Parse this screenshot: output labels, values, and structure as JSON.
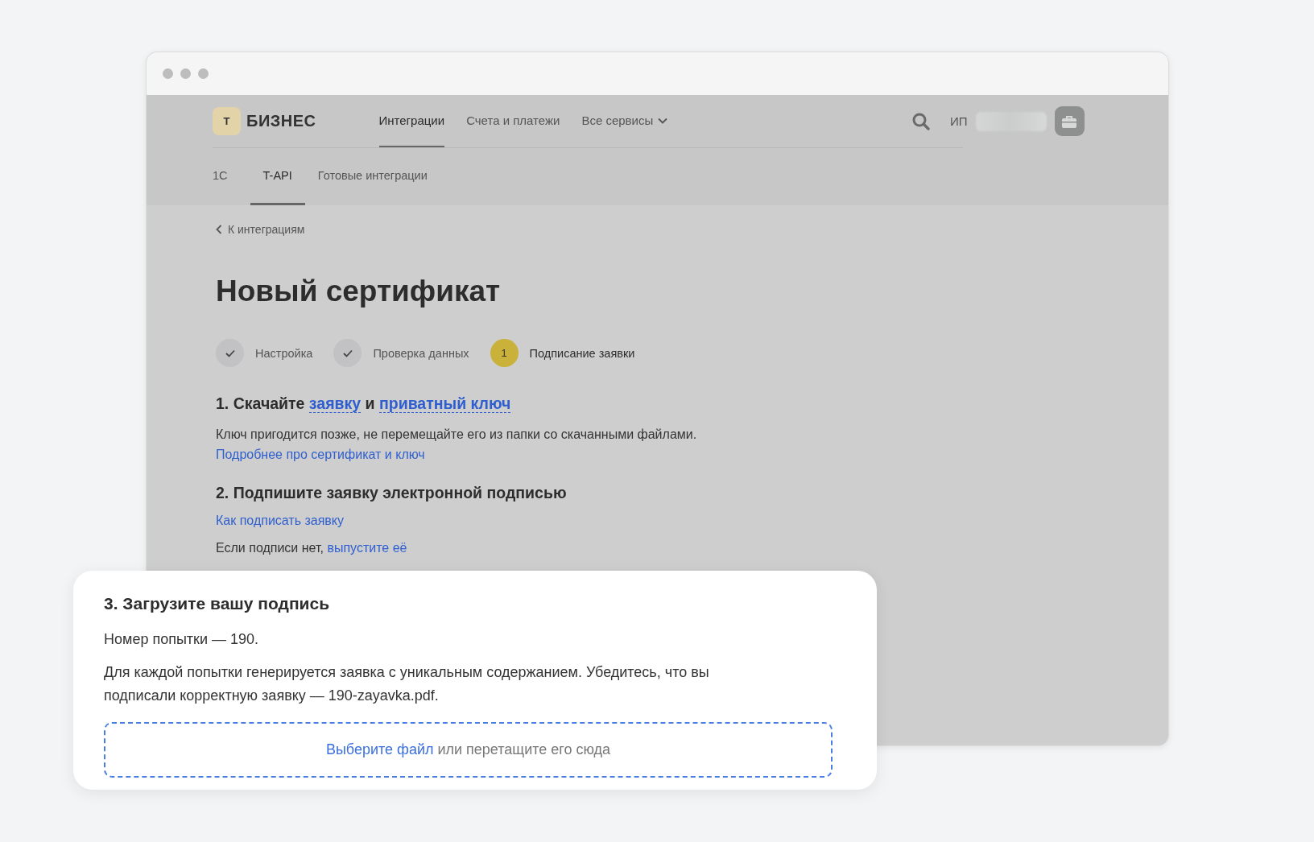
{
  "header": {
    "logo_mark": "Т",
    "logo_text": "БИЗНЕС",
    "nav": [
      {
        "label": "Интеграции",
        "selected": true,
        "dropdown": false
      },
      {
        "label": "Счета и платежи",
        "selected": false,
        "dropdown": false
      },
      {
        "label": "Все сервисы",
        "selected": false,
        "dropdown": true
      }
    ],
    "account_label": "ИП"
  },
  "subtabs": [
    {
      "label": "1С",
      "selected": false
    },
    {
      "label": "T-API",
      "selected": true
    },
    {
      "label": "Готовые интеграции",
      "selected": false
    }
  ],
  "back_link": "К интеграциям",
  "title": "Новый сертификат",
  "steps": [
    {
      "label": "Настройка",
      "kind": "done"
    },
    {
      "label": "Проверка данных",
      "kind": "done"
    },
    {
      "label": "Подписание заявки",
      "kind": "current",
      "number": "1"
    }
  ],
  "section1": {
    "heading": [
      {
        "text": "1. Скачайте ",
        "link": false
      },
      {
        "text": "заявку",
        "link": true
      },
      {
        "text": " и ",
        "link": false
      },
      {
        "text": "приватный ключ",
        "link": true
      }
    ],
    "note": "Ключ пригодится позже, не перемещайте его из папки со скачанными файлами.",
    "note_link": "Подробнее про сертификат и ключ"
  },
  "section2": {
    "heading": "2. Подпишите заявку электронной подписью",
    "link": "Как подписать заявку",
    "hint": "Если подписи нет,",
    "hint_link": "выпустите её"
  },
  "card": {
    "heading": "3. Загрузите вашу подпись",
    "attempt": "Номер попытки — 190.",
    "note": "Для каждой попытки генерируется заявка с уникальным содержанием. Убедитесь, что вы подписали корректную заявку — 190-zayavka.pdf.",
    "dropzone": {
      "link": "Выберите файл",
      "text": "или перетащите его сюда"
    }
  }
}
